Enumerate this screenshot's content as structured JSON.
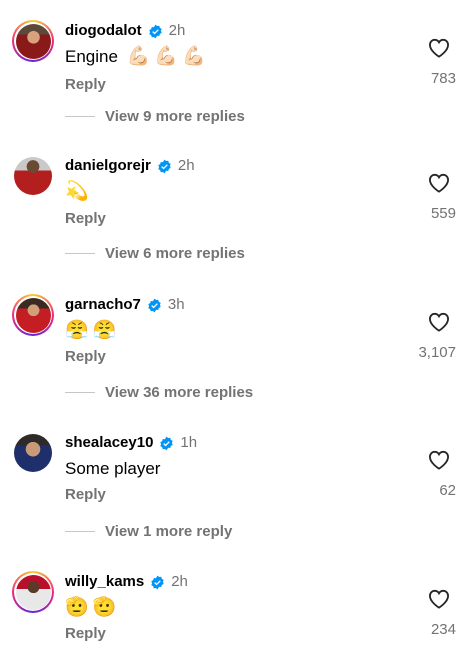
{
  "colors": {
    "verified": "#0095f6",
    "secondary_text": "#737373",
    "primary_text": "#000000"
  },
  "comments": [
    {
      "username": "diogodalot",
      "time": "2h",
      "text": "Engine",
      "emojis": [
        "💪🏻",
        "💪🏻",
        "💪🏻"
      ],
      "reply_label": "Reply",
      "likes": "783",
      "more_replies": "View 9 more replies",
      "verified": true
    },
    {
      "username": "danielgorejr",
      "time": "2h",
      "text": "",
      "emojis": [
        "💫"
      ],
      "reply_label": "Reply",
      "likes": "559",
      "more_replies": "View 6 more replies",
      "verified": true
    },
    {
      "username": "garnacho7",
      "time": "3h",
      "text": "",
      "emojis": [
        "😤",
        "😤"
      ],
      "reply_label": "Reply",
      "likes": "3,107",
      "more_replies": "View 36 more replies",
      "verified": true
    },
    {
      "username": "shealacey10",
      "time": "1h",
      "text": "Some player",
      "emojis": [],
      "reply_label": "Reply",
      "likes": "62",
      "more_replies": "View 1 more reply",
      "verified": false
    },
    {
      "username": "willy_kams",
      "time": "2h",
      "text": "",
      "emojis": [
        "🫡",
        "🫡"
      ],
      "reply_label": "Reply",
      "likes": "234",
      "more_replies": "",
      "verified": true
    }
  ]
}
